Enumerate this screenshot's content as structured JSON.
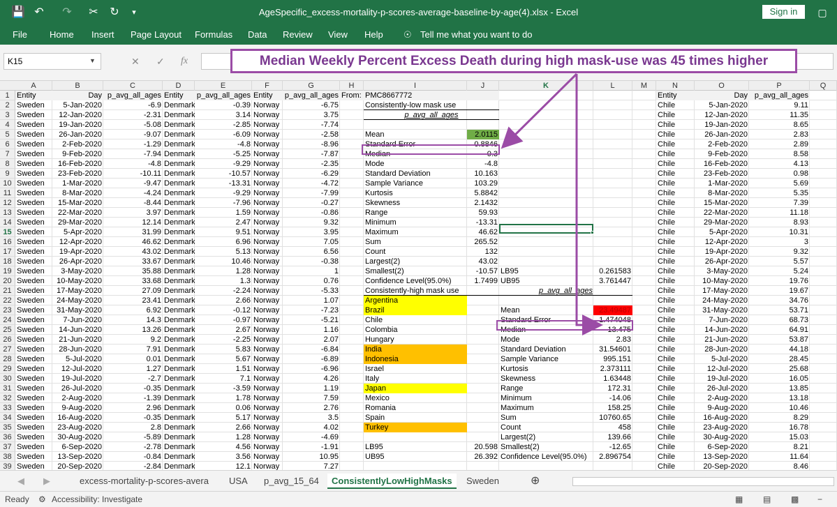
{
  "window": {
    "title": "AgeSpecific_excess-mortality-p-scores-average-baseline-by-age(4).xlsx  -  Excel",
    "sign_in": "Sign in"
  },
  "ribbon": {
    "tabs": [
      "File",
      "Home",
      "Insert",
      "Page Layout",
      "Formulas",
      "Data",
      "Review",
      "View",
      "Help",
      "Tell me what you want to do"
    ]
  },
  "formula_bar": {
    "name_box": "K15",
    "cancel_glyph": "✕",
    "enter_glyph": "✓",
    "fx_label": "fx"
  },
  "annotation": {
    "text": "Median Weekly Percent Excess Death during high mask-use was 45 times higher"
  },
  "columns": [
    "A",
    "B",
    "C",
    "D",
    "E",
    "F",
    "G",
    "H",
    "I",
    "J",
    "K",
    "L",
    "M",
    "N",
    "O",
    "P",
    "Q"
  ],
  "rows": [
    {
      "n": "1",
      "a": "Entity",
      "b": "Day",
      "c": "p_avg_all_ages",
      "d": "Entity",
      "e": "p_avg_all_ages",
      "f": "Entity",
      "g": "p_avg_all_ages",
      "h": "From:",
      "i": "PMC8667772",
      "j": "",
      "k": "",
      "l": "",
      "n2": "Entity",
      "o": "Day",
      "p": "p_avg_all_ages"
    },
    {
      "n": "2",
      "a": "Sweden",
      "b": "5-Jan-2020",
      "c": "-6.9",
      "d": "Denmark",
      "e": "-0.39",
      "f": "Norway",
      "g": "-6.75",
      "i": "Consistently-low mask use",
      "j": "",
      "k": "",
      "l": "",
      "n2": "Chile",
      "o": "5-Jan-2020",
      "p": "9.11"
    },
    {
      "n": "3",
      "a": "Sweden",
      "b": "12-Jan-2020",
      "c": "-2.31",
      "d": "Denmark",
      "e": "3.14",
      "f": "Norway",
      "g": "3.75",
      "i": "p_avg_all_ages",
      "j": "",
      "k": "",
      "l": "",
      "n2": "Chile",
      "o": "12-Jan-2020",
      "p": "11.35"
    },
    {
      "n": "4",
      "a": "Sweden",
      "b": "19-Jan-2020",
      "c": "-5.08",
      "d": "Denmark",
      "e": "-2.85",
      "f": "Norway",
      "g": "-7.74",
      "i": "",
      "j": "",
      "k": "",
      "l": "",
      "n2": "Chile",
      "o": "19-Jan-2020",
      "p": "8.65"
    },
    {
      "n": "5",
      "a": "Sweden",
      "b": "26-Jan-2020",
      "c": "-9.07",
      "d": "Denmark",
      "e": "-6.09",
      "f": "Norway",
      "g": "-2.58",
      "i": "Mean",
      "j": "2.0115",
      "k": "",
      "l": "",
      "n2": "Chile",
      "o": "26-Jan-2020",
      "p": "2.83"
    },
    {
      "n": "6",
      "a": "Sweden",
      "b": "2-Feb-2020",
      "c": "-1.29",
      "d": "Denmark",
      "e": "-4.8",
      "f": "Norway",
      "g": "-8.96",
      "i": "Standard Error",
      "j": "0.8846",
      "k": "",
      "l": "",
      "n2": "Chile",
      "o": "2-Feb-2020",
      "p": "2.89"
    },
    {
      "n": "7",
      "a": "Sweden",
      "b": "9-Feb-2020",
      "c": "-7.94",
      "d": "Denmark",
      "e": "-5.25",
      "f": "Norway",
      "g": "-7.87",
      "i": "Median",
      "j": "0.3",
      "k": "",
      "l": "",
      "n2": "Chile",
      "o": "9-Feb-2020",
      "p": "8.58"
    },
    {
      "n": "8",
      "a": "Sweden",
      "b": "16-Feb-2020",
      "c": "-4.8",
      "d": "Denmark",
      "e": "-9.29",
      "f": "Norway",
      "g": "-2.35",
      "i": "Mode",
      "j": "-4.8",
      "k": "",
      "l": "",
      "n2": "Chile",
      "o": "16-Feb-2020",
      "p": "4.13"
    },
    {
      "n": "9",
      "a": "Sweden",
      "b": "23-Feb-2020",
      "c": "-10.11",
      "d": "Denmark",
      "e": "-10.57",
      "f": "Norway",
      "g": "-6.29",
      "i": "Standard Deviation",
      "j": "10.163",
      "k": "",
      "l": "",
      "n2": "Chile",
      "o": "23-Feb-2020",
      "p": "0.98"
    },
    {
      "n": "10",
      "a": "Sweden",
      "b": "1-Mar-2020",
      "c": "-9.47",
      "d": "Denmark",
      "e": "-13.31",
      "f": "Norway",
      "g": "-4.72",
      "i": "Sample Variance",
      "j": "103.29",
      "k": "",
      "l": "",
      "n2": "Chile",
      "o": "1-Mar-2020",
      "p": "5.69"
    },
    {
      "n": "11",
      "a": "Sweden",
      "b": "8-Mar-2020",
      "c": "-4.24",
      "d": "Denmark",
      "e": "-9.29",
      "f": "Norway",
      "g": "-7.99",
      "i": "Kurtosis",
      "j": "5.8842",
      "k": "",
      "l": "",
      "n2": "Chile",
      "o": "8-Mar-2020",
      "p": "5.35"
    },
    {
      "n": "12",
      "a": "Sweden",
      "b": "15-Mar-2020",
      "c": "-8.44",
      "d": "Denmark",
      "e": "-7.96",
      "f": "Norway",
      "g": "-0.27",
      "i": "Skewness",
      "j": "2.1432",
      "k": "",
      "l": "",
      "n2": "Chile",
      "o": "15-Mar-2020",
      "p": "7.39"
    },
    {
      "n": "13",
      "a": "Sweden",
      "b": "22-Mar-2020",
      "c": "3.97",
      "d": "Denmark",
      "e": "1.59",
      "f": "Norway",
      "g": "-0.86",
      "i": "Range",
      "j": "59.93",
      "k": "",
      "l": "",
      "n2": "Chile",
      "o": "22-Mar-2020",
      "p": "11.18"
    },
    {
      "n": "14",
      "a": "Sweden",
      "b": "29-Mar-2020",
      "c": "12.14",
      "d": "Denmark",
      "e": "2.47",
      "f": "Norway",
      "g": "9.32",
      "i": "Minimum",
      "j": "-13.31",
      "k": "",
      "l": "",
      "n2": "Chile",
      "o": "29-Mar-2020",
      "p": "8.93"
    },
    {
      "n": "15",
      "a": "Sweden",
      "b": "5-Apr-2020",
      "c": "31.99",
      "d": "Denmark",
      "e": "9.51",
      "f": "Norway",
      "g": "3.95",
      "i": "Maximum",
      "j": "46.62",
      "k": "",
      "l": "",
      "n2": "Chile",
      "o": "5-Apr-2020",
      "p": "10.31"
    },
    {
      "n": "16",
      "a": "Sweden",
      "b": "12-Apr-2020",
      "c": "46.62",
      "d": "Denmark",
      "e": "6.96",
      "f": "Norway",
      "g": "7.05",
      "i": "Sum",
      "j": "265.52",
      "k": "",
      "l": "",
      "n2": "Chile",
      "o": "12-Apr-2020",
      "p": "3"
    },
    {
      "n": "17",
      "a": "Sweden",
      "b": "19-Apr-2020",
      "c": "43.02",
      "d": "Denmark",
      "e": "5.13",
      "f": "Norway",
      "g": "6.56",
      "i": "Count",
      "j": "132",
      "k": "",
      "l": "",
      "n2": "Chile",
      "o": "19-Apr-2020",
      "p": "9.32"
    },
    {
      "n": "18",
      "a": "Sweden",
      "b": "26-Apr-2020",
      "c": "33.67",
      "d": "Denmark",
      "e": "10.46",
      "f": "Norway",
      "g": "-0.38",
      "i": "Largest(2)",
      "j": "43.02",
      "k": "",
      "l": "",
      "n2": "Chile",
      "o": "26-Apr-2020",
      "p": "5.57"
    },
    {
      "n": "19",
      "a": "Sweden",
      "b": "3-May-2020",
      "c": "35.88",
      "d": "Denmark",
      "e": "1.28",
      "f": "Norway",
      "g": "1",
      "i": "Smallest(2)",
      "j": "-10.57",
      "k": "LB95",
      "l": "0.261583",
      "n2": "Chile",
      "o": "3-May-2020",
      "p": "5.24"
    },
    {
      "n": "20",
      "a": "Sweden",
      "b": "10-May-2020",
      "c": "33.68",
      "d": "Denmark",
      "e": "1.3",
      "f": "Norway",
      "g": "0.76",
      "i": "Confidence Level(95.0%)",
      "j": "1.7499",
      "k": "UB95",
      "l": "3.761447",
      "n2": "Chile",
      "o": "10-May-2020",
      "p": "19.76"
    },
    {
      "n": "21",
      "a": "Sweden",
      "b": "17-May-2020",
      "c": "27.09",
      "d": "Denmark",
      "e": "-2.24",
      "f": "Norway",
      "g": "-5.33",
      "i": "Consistently-high mask use",
      "j": "",
      "k": "p_avg_all_ages",
      "l": "",
      "n2": "Chile",
      "o": "17-May-2020",
      "p": "19.67"
    },
    {
      "n": "22",
      "a": "Sweden",
      "b": "24-May-2020",
      "c": "23.41",
      "d": "Denmark",
      "e": "2.66",
      "f": "Norway",
      "g": "1.07",
      "i": "Argentina",
      "j": "",
      "k": "",
      "l": "",
      "n2": "Chile",
      "o": "24-May-2020",
      "p": "34.76"
    },
    {
      "n": "23",
      "a": "Sweden",
      "b": "31-May-2020",
      "c": "6.92",
      "d": "Denmark",
      "e": "-0.12",
      "f": "Norway",
      "g": "-7.23",
      "i": "Brazil",
      "j": "",
      "k": "Mean",
      "l": "23.49487",
      "n2": "Chile",
      "o": "31-May-2020",
      "p": "53.71"
    },
    {
      "n": "24",
      "a": "Sweden",
      "b": "7-Jun-2020",
      "c": "14.3",
      "d": "Denmark",
      "e": "-0.97",
      "f": "Norway",
      "g": "-5.21",
      "i": "Chile",
      "j": "",
      "k": "Standard Error",
      "l": "1.474048",
      "n2": "Chile",
      "o": "7-Jun-2020",
      "p": "68.73"
    },
    {
      "n": "25",
      "a": "Sweden",
      "b": "14-Jun-2020",
      "c": "13.26",
      "d": "Denmark",
      "e": "2.67",
      "f": "Norway",
      "g": "1.16",
      "i": "Colombia",
      "j": "",
      "k": "Median",
      "l": "13.475",
      "n2": "Chile",
      "o": "14-Jun-2020",
      "p": "64.91"
    },
    {
      "n": "26",
      "a": "Sweden",
      "b": "21-Jun-2020",
      "c": "9.2",
      "d": "Denmark",
      "e": "-2.25",
      "f": "Norway",
      "g": "2.07",
      "i": "Hungary",
      "j": "",
      "k": "Mode",
      "l": "2.83",
      "n2": "Chile",
      "o": "21-Jun-2020",
      "p": "53.87"
    },
    {
      "n": "27",
      "a": "Sweden",
      "b": "28-Jun-2020",
      "c": "7.91",
      "d": "Denmark",
      "e": "5.83",
      "f": "Norway",
      "g": "-6.84",
      "i": "India",
      "j": "",
      "k": "Standard Deviation",
      "l": "31.54601",
      "n2": "Chile",
      "o": "28-Jun-2020",
      "p": "44.18"
    },
    {
      "n": "28",
      "a": "Sweden",
      "b": "5-Jul-2020",
      "c": "0.01",
      "d": "Denmark",
      "e": "5.67",
      "f": "Norway",
      "g": "-6.89",
      "i": "Indonesia",
      "j": "",
      "k": "Sample Variance",
      "l": "995.151",
      "n2": "Chile",
      "o": "5-Jul-2020",
      "p": "28.45"
    },
    {
      "n": "29",
      "a": "Sweden",
      "b": "12-Jul-2020",
      "c": "1.27",
      "d": "Denmark",
      "e": "1.51",
      "f": "Norway",
      "g": "-6.96",
      "i": "Israel",
      "j": "",
      "k": "Kurtosis",
      "l": "2.373111",
      "n2": "Chile",
      "o": "12-Jul-2020",
      "p": "25.68"
    },
    {
      "n": "30",
      "a": "Sweden",
      "b": "19-Jul-2020",
      "c": "-2.7",
      "d": "Denmark",
      "e": "7.1",
      "f": "Norway",
      "g": "4.26",
      "i": "Italy",
      "j": "",
      "k": "Skewness",
      "l": "1.63448",
      "n2": "Chile",
      "o": "19-Jul-2020",
      "p": "16.05"
    },
    {
      "n": "31",
      "a": "Sweden",
      "b": "26-Jul-2020",
      "c": "-0.35",
      "d": "Denmark",
      "e": "-3.59",
      "f": "Norway",
      "g": "1.19",
      "i": "Japan",
      "j": "",
      "k": "Range",
      "l": "172.31",
      "n2": "Chile",
      "o": "26-Jul-2020",
      "p": "13.85"
    },
    {
      "n": "32",
      "a": "Sweden",
      "b": "2-Aug-2020",
      "c": "-1.39",
      "d": "Denmark",
      "e": "1.78",
      "f": "Norway",
      "g": "7.59",
      "i": "Mexico",
      "j": "",
      "k": "Minimum",
      "l": "-14.06",
      "n2": "Chile",
      "o": "2-Aug-2020",
      "p": "13.18"
    },
    {
      "n": "33",
      "a": "Sweden",
      "b": "9-Aug-2020",
      "c": "2.96",
      "d": "Denmark",
      "e": "0.06",
      "f": "Norway",
      "g": "2.76",
      "i": "Romania",
      "j": "",
      "k": "Maximum",
      "l": "158.25",
      "n2": "Chile",
      "o": "9-Aug-2020",
      "p": "10.46"
    },
    {
      "n": "34",
      "a": "Sweden",
      "b": "16-Aug-2020",
      "c": "-0.35",
      "d": "Denmark",
      "e": "5.17",
      "f": "Norway",
      "g": "3.5",
      "i": "Spain",
      "j": "",
      "k": "Sum",
      "l": "10760.65",
      "n2": "Chile",
      "o": "16-Aug-2020",
      "p": "8.29"
    },
    {
      "n": "35",
      "a": "Sweden",
      "b": "23-Aug-2020",
      "c": "2.8",
      "d": "Denmark",
      "e": "2.66",
      "f": "Norway",
      "g": "4.02",
      "i": "Turkey",
      "j": "",
      "k": "Count",
      "l": "458",
      "n2": "Chile",
      "o": "23-Aug-2020",
      "p": "16.78"
    },
    {
      "n": "36",
      "a": "Sweden",
      "b": "30-Aug-2020",
      "c": "-5.89",
      "d": "Denmark",
      "e": "1.28",
      "f": "Norway",
      "g": "-4.69",
      "i": "",
      "j": "",
      "k": "Largest(2)",
      "l": "139.66",
      "n2": "Chile",
      "o": "30-Aug-2020",
      "p": "15.03"
    },
    {
      "n": "37",
      "a": "Sweden",
      "b": "6-Sep-2020",
      "c": "-2.78",
      "d": "Denmark",
      "e": "4.56",
      "f": "Norway",
      "g": "-1.91",
      "i": "LB95",
      "j": "20.598",
      "k": "Smallest(2)",
      "l": "-12.65",
      "n2": "Chile",
      "o": "6-Sep-2020",
      "p": "8.21"
    },
    {
      "n": "38",
      "a": "Sweden",
      "b": "13-Sep-2020",
      "c": "-0.84",
      "d": "Denmark",
      "e": "3.56",
      "f": "Norway",
      "g": "10.95",
      "i": "UB95",
      "j": "26.392",
      "k": "Confidence Level(95.0%)",
      "l": "2.896754",
      "n2": "Chile",
      "o": "13-Sep-2020",
      "p": "11.64"
    },
    {
      "n": "39",
      "a": "Sweden",
      "b": "20-Sep-2020",
      "c": "-2.84",
      "d": "Denmark",
      "e": "12.1",
      "f": "Norway",
      "g": "7.27",
      "i": "",
      "j": "",
      "k": "",
      "l": "",
      "n2": "Chile",
      "o": "20-Sep-2020",
      "p": "8.46"
    }
  ],
  "highlights": {
    "yellow_countries": [
      "Argentina",
      "Brazil",
      "Japan"
    ],
    "orange_countries": [
      "India",
      "Indonesia",
      "Turkey"
    ],
    "green_cell": "2.0115",
    "red_cell": "23.49487",
    "colors": {
      "yellow": "#ffff00",
      "orange": "#ffc000",
      "green": "#70ad47",
      "red": "#ff0000",
      "purple": "#9b4ca6",
      "excel_green": "#217346"
    }
  },
  "sheet_tabs": [
    "excess-mortality-p-scores-avera",
    "USA",
    "p_avg_15_64",
    "ConsistentlyLowHighMasks",
    "Sweden"
  ],
  "active_sheet": "ConsistentlyLowHighMasks",
  "status": {
    "ready": "Ready",
    "accessibility": "Accessibility: Investigate"
  }
}
